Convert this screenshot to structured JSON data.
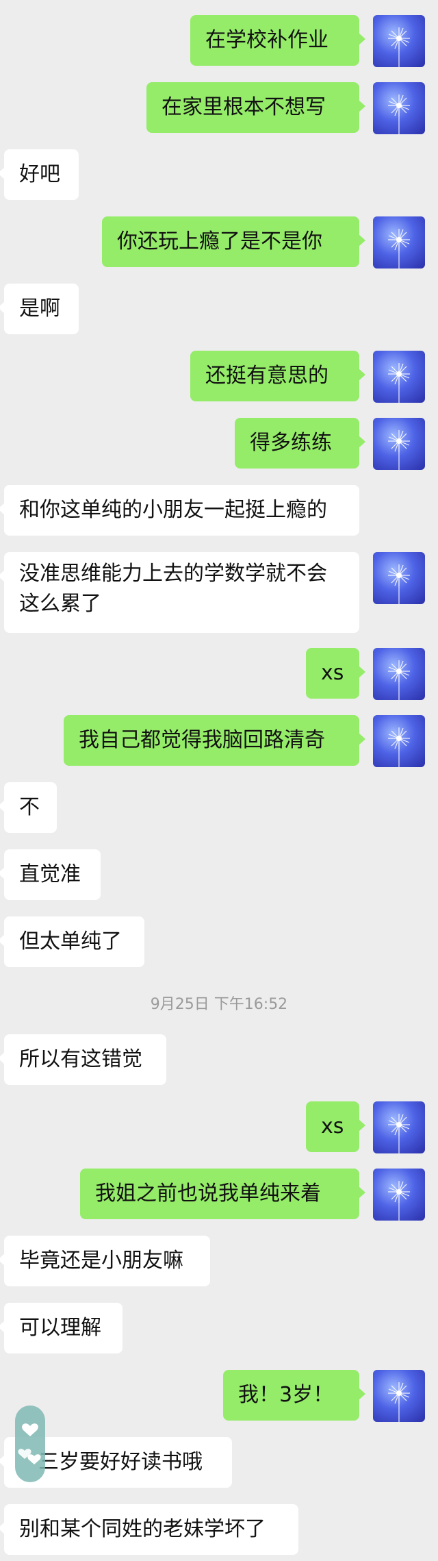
{
  "colors": {
    "background": "#ededed",
    "outgoing_bubble": "#95ec69",
    "incoming_bubble": "#ffffff",
    "timestamp_text": "#9a9a9a"
  },
  "avatar": {
    "icon": "dandelion-icon"
  },
  "timestamp": "9月25日 下午16:52",
  "messages": [
    {
      "side": "right",
      "text": "在学校补作业"
    },
    {
      "side": "right",
      "text": "在家里根本不想写"
    },
    {
      "side": "left",
      "text": "好吧"
    },
    {
      "side": "right",
      "text": "你还玩上瘾了是不是你"
    },
    {
      "side": "left",
      "text": "是啊"
    },
    {
      "side": "right",
      "text": "还挺有意思的"
    },
    {
      "side": "right",
      "text": "得多练练"
    },
    {
      "side": "left",
      "text": "和你这单纯的小朋友一起挺上瘾的"
    },
    {
      "side": "left",
      "text": "没准思维能力上去的学数学就不会这么累了"
    },
    {
      "side": "right",
      "text": "xs"
    },
    {
      "side": "right",
      "text": "我自己都觉得我脑回路清奇"
    },
    {
      "side": "left",
      "text": "不"
    },
    {
      "side": "left",
      "text": "直觉准"
    },
    {
      "side": "left",
      "text": "但太单纯了"
    },
    {
      "side": "left",
      "text": "所以有这错觉"
    },
    {
      "side": "right",
      "text": "xs"
    },
    {
      "side": "right",
      "text": "我姐之前也说我单纯来着"
    },
    {
      "side": "left",
      "text": "毕竟还是小朋友嘛"
    },
    {
      "side": "left",
      "text": "可以理解"
    },
    {
      "side": "right",
      "text": "我！3岁！"
    },
    {
      "side": "left",
      "text": "三岁要好好读书哦"
    },
    {
      "side": "left",
      "text": "别和某个同姓的老妹学坏了"
    }
  ]
}
